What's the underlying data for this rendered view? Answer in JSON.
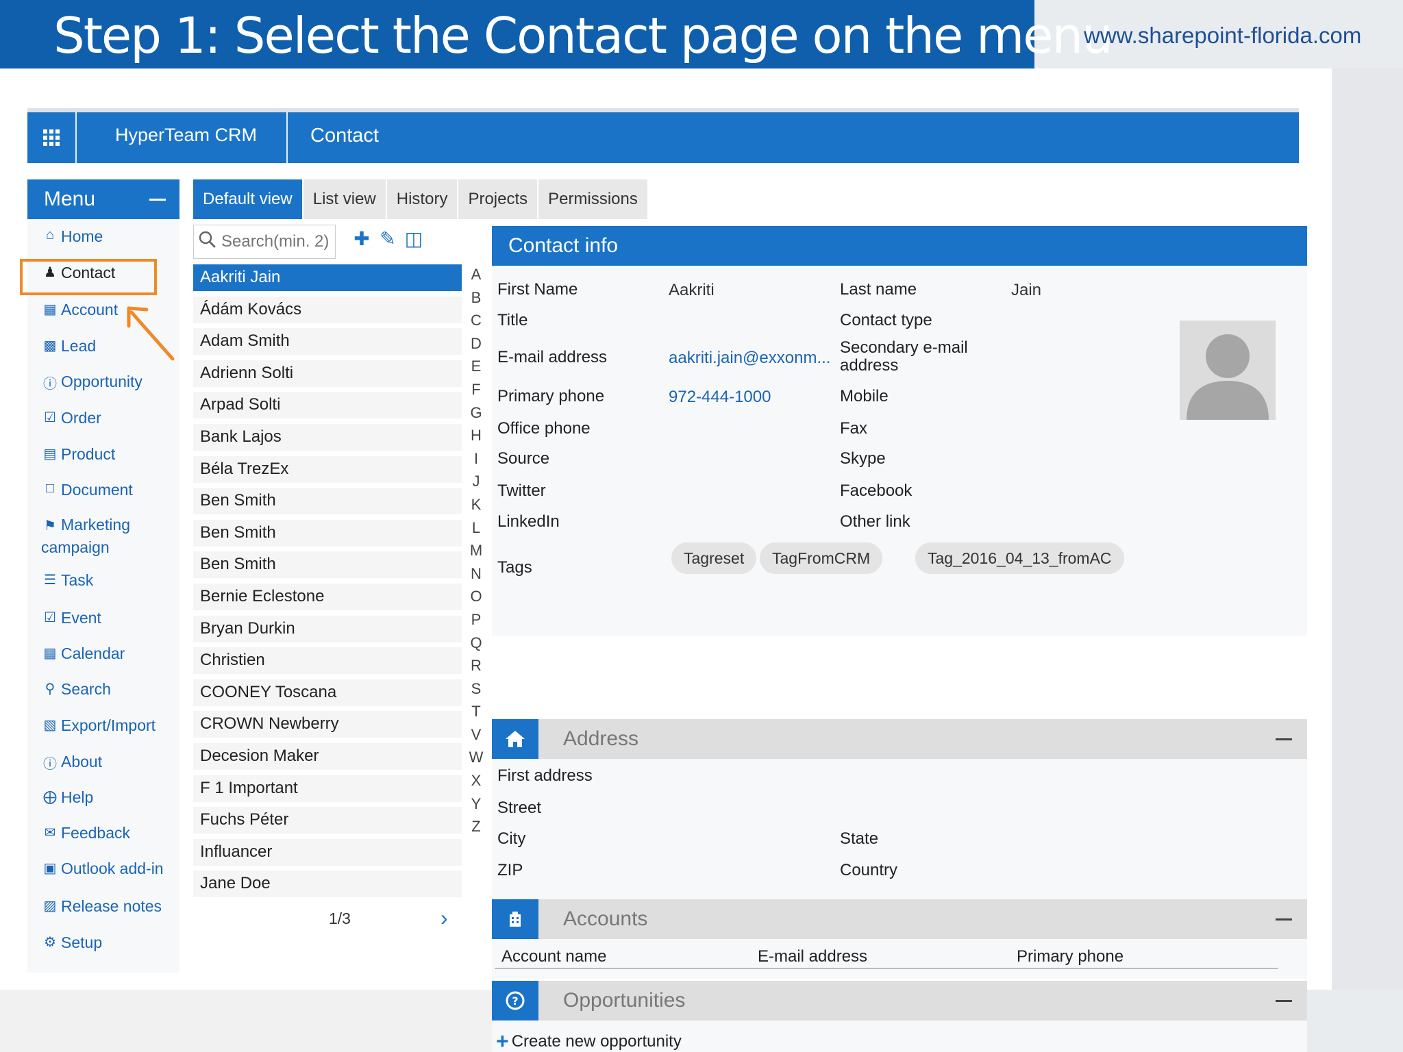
{
  "slide": {
    "title": "Step 1: Select the Contact page on the menu",
    "url": "www.sharepoint-florida.com"
  },
  "colors": {
    "accent": "#1b73c7",
    "banner": "#0f5fad",
    "highlight": "#f08a28"
  },
  "topbar": {
    "app_name": "HyperTeam CRM",
    "page_name": "Contact"
  },
  "sidebar": {
    "header": "Menu",
    "items": [
      {
        "label": "Home",
        "icon": "home-icon"
      },
      {
        "label": "Contact",
        "icon": "user-icon"
      },
      {
        "label": "Account",
        "icon": "building-icon"
      },
      {
        "label": "Lead",
        "icon": "inbox-icon"
      },
      {
        "label": "Opportunity",
        "icon": "question-circle-icon"
      },
      {
        "label": "Order",
        "icon": "check-square-icon"
      },
      {
        "label": "Product",
        "icon": "shopping-cart-icon"
      },
      {
        "label": "Document",
        "icon": "file-icon"
      },
      {
        "label": "Marketing campaign",
        "icon": "flag-icon"
      },
      {
        "label": "Task",
        "icon": "list-icon"
      },
      {
        "label": "Event",
        "icon": "calendar-check-icon"
      },
      {
        "label": "Calendar",
        "icon": "calendar-icon"
      },
      {
        "label": "Search",
        "icon": "search-icon"
      },
      {
        "label": "Export/Import",
        "icon": "export-icon"
      },
      {
        "label": "About",
        "icon": "info-icon"
      },
      {
        "label": "Help",
        "icon": "lifebuoy-icon"
      },
      {
        "label": "Feedback",
        "icon": "envelope-icon"
      },
      {
        "label": "Outlook add-in",
        "icon": "outlook-icon"
      },
      {
        "label": "Release notes",
        "icon": "rss-icon"
      },
      {
        "label": "Setup",
        "icon": "gears-icon"
      }
    ]
  },
  "tabs": [
    "Default view",
    "List view",
    "History",
    "Projects",
    "Permissions"
  ],
  "search": {
    "placeholder": "Search(min. 2)"
  },
  "contacts": [
    "Aakriti Jain",
    "Ádám Kovács",
    "Adam Smith",
    "Adrienn Solti",
    "Arpad Solti",
    "Bank Lajos",
    "Béla TrezEx",
    "Ben Smith",
    "Ben Smith",
    "Ben Smith",
    "Bernie Eclestone",
    "Bryan Durkin",
    "Christien",
    "COONEY Toscana",
    "CROWN Newberry",
    "Decesion Maker",
    "F 1 Important",
    "Fuchs Péter",
    "Influancer",
    "Jane Doe"
  ],
  "pager": {
    "text": "1/3"
  },
  "alphabet": [
    "A",
    "B",
    "C",
    "D",
    "E",
    "F",
    "G",
    "H",
    "I",
    "J",
    "K",
    "L",
    "M",
    "N",
    "O",
    "P",
    "Q",
    "R",
    "S",
    "T",
    "V",
    "W",
    "X",
    "Y",
    "Z"
  ],
  "contact_info": {
    "header": "Contact info",
    "first_name_label": "First Name",
    "first_name": "Aakriti",
    "last_name_label": "Last name",
    "last_name": "Jain",
    "title_label": "Title",
    "contact_type_label": "Contact type",
    "email_label": "E-mail address",
    "email": "aakriti.jain@exxonm...",
    "secondary_email_label_1": "Secondary e-mail",
    "secondary_email_label_2": "address",
    "primary_phone_label": "Primary phone",
    "primary_phone": "972-444-1000",
    "mobile_label": "Mobile",
    "office_phone_label": "Office phone",
    "fax_label": "Fax",
    "source_label": "Source",
    "skype_label": "Skype",
    "twitter_label": "Twitter",
    "facebook_label": "Facebook",
    "linkedin_label": "LinkedIn",
    "other_link_label": "Other link",
    "tags_label": "Tags",
    "tags": [
      "Tagreset",
      "TagFromCRM",
      "Tag_2016_04_13_fromAC"
    ]
  },
  "address": {
    "header": "Address",
    "first_address_label": "First address",
    "street_label": "Street",
    "city_label": "City",
    "state_label": "State",
    "zip_label": "ZIP",
    "country_label": "Country"
  },
  "accounts": {
    "header": "Accounts",
    "columns": [
      "Account name",
      "E-mail address",
      "Primary phone"
    ]
  },
  "opportunities": {
    "header": "Opportunities",
    "create_label": "Create new opportunity"
  }
}
